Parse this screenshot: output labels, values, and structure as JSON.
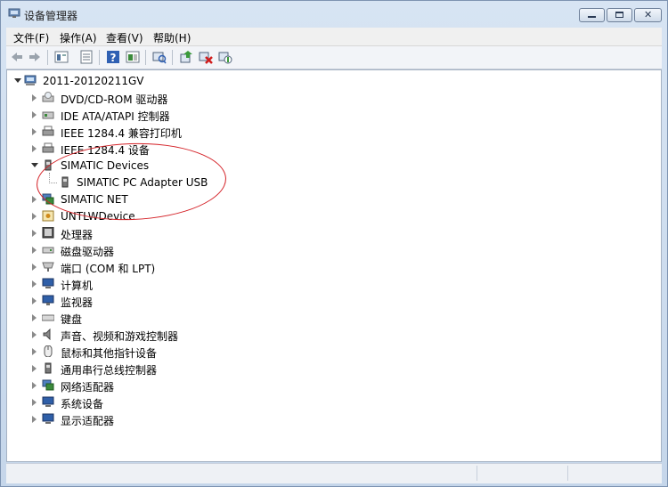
{
  "window": {
    "title": "设备管理器"
  },
  "menu": [
    "文件(F)",
    "操作(A)",
    "查看(V)",
    "帮助(H)"
  ],
  "toolbar": {
    "icons": [
      "back-arrow-icon",
      "forward-arrow-icon",
      "properties-icon",
      "update-driver-icon",
      "help-icon",
      "view-icon",
      "scan-hardware-icon",
      "update-icon",
      "uninstall-icon",
      "enable-icon"
    ]
  },
  "tree": {
    "root": "2011-20120211GV",
    "items": [
      {
        "label": "DVD/CD-ROM 驱动器",
        "icon": "dvd-drive-icon",
        "expanded": false
      },
      {
        "label": "IDE ATA/ATAPI 控制器",
        "icon": "ide-controller-icon",
        "expanded": false
      },
      {
        "label": "IEEE 1284.4 兼容打印机",
        "icon": "printer-icon",
        "expanded": false
      },
      {
        "label": "IEEE 1284.4 设备",
        "icon": "printer-icon",
        "expanded": false
      },
      {
        "label": "SIMATIC Devices",
        "icon": "simatic-devices-icon",
        "expanded": true,
        "children": [
          {
            "label": "SIMATIC PC Adapter USB",
            "icon": "usb-adapter-icon"
          }
        ]
      },
      {
        "label": "SIMATIC NET",
        "icon": "simatic-net-icon",
        "expanded": false
      },
      {
        "label": "UNTLWDevice",
        "icon": "device-icon",
        "expanded": false
      },
      {
        "label": "处理器",
        "icon": "processor-icon",
        "expanded": false
      },
      {
        "label": "磁盘驱动器",
        "icon": "disk-drive-icon",
        "expanded": false
      },
      {
        "label": "端口 (COM 和 LPT)",
        "icon": "port-icon",
        "expanded": false
      },
      {
        "label": "计算机",
        "icon": "computer-icon",
        "expanded": false
      },
      {
        "label": "监视器",
        "icon": "monitor-icon",
        "expanded": false
      },
      {
        "label": "键盘",
        "icon": "keyboard-icon",
        "expanded": false
      },
      {
        "label": "声音、视频和游戏控制器",
        "icon": "sound-icon",
        "expanded": false
      },
      {
        "label": "鼠标和其他指针设备",
        "icon": "mouse-icon",
        "expanded": false
      },
      {
        "label": "通用串行总线控制器",
        "icon": "usb-controller-icon",
        "expanded": false
      },
      {
        "label": "网络适配器",
        "icon": "network-adapter-icon",
        "expanded": false
      },
      {
        "label": "系统设备",
        "icon": "system-device-icon",
        "expanded": false
      },
      {
        "label": "显示适配器",
        "icon": "display-adapter-icon",
        "expanded": false
      }
    ]
  },
  "annotation": {
    "color": "#d42026"
  }
}
